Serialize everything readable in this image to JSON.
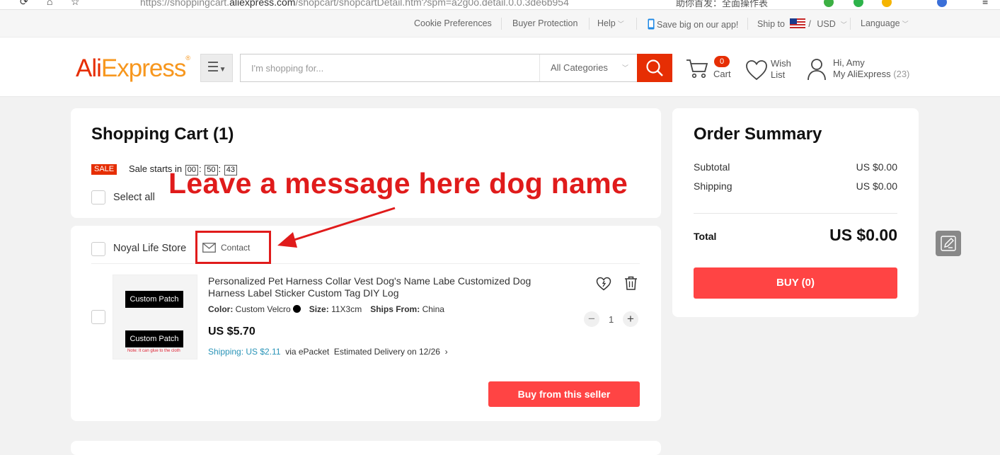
{
  "browser": {
    "url_prefix": "https://shoppingcart.",
    "url_domain": "aliexpress.com",
    "url_path": "/shopcart/shopcartDetail.htm?spm=a2g0o.detail.0.0.3de6b954",
    "cn_text": "助你首发：全面操作表"
  },
  "topnav": {
    "cookie": "Cookie Preferences",
    "buyer_protection": "Buyer Protection",
    "help": "Help",
    "app": "Save big on our app!",
    "ship_to": "Ship to",
    "currency_sep": "/",
    "currency": "USD",
    "language": "Language"
  },
  "header": {
    "logo_part1": "Ali",
    "logo_part2": "Express",
    "logo_tm": "®",
    "search_placeholder": "I'm shopping for...",
    "category": "All Categories",
    "cart_count": "0",
    "cart_label": "Cart",
    "wish_line1": "Wish",
    "wish_line2": "List",
    "greeting": "Hi, Amy",
    "account": "My AliExpress",
    "account_count": "(23)"
  },
  "cart": {
    "title": "Shopping Cart (1)",
    "sale_badge": "SALE",
    "sale_text": "Sale starts in",
    "timer_h": "00",
    "timer_m": "50",
    "timer_s": "43",
    "timer_sep": ":",
    "select_all": "Select all"
  },
  "annotation": {
    "text": "Leave a message here dog name"
  },
  "store": {
    "name": "Noyal Life Store",
    "contact": "Contact"
  },
  "product": {
    "image_text_1": "Custom Patch",
    "image_text_2": "Custom Patch",
    "image_note": "Note: It can glue to the cloth",
    "name": "Personalized Pet Harness Collar Vest Dog's Name Labe Customized Dog Harness Label Sticker Custom Tag DIY Log",
    "color_label": "Color:",
    "color_value": "Custom Velcro",
    "size_label": "Size:",
    "size_value": "11X3cm",
    "ships_label": "Ships From:",
    "ships_value": "China",
    "price": "US $5.70",
    "shipping_label": "Shipping: US $2.11",
    "shipping_via": "via ePacket",
    "delivery": "Estimated Delivery on 12/26",
    "quantity": "1",
    "buy_seller": "Buy from this seller"
  },
  "summary": {
    "title": "Order Summary",
    "subtotal_label": "Subtotal",
    "subtotal_value": "US $0.00",
    "shipping_label": "Shipping",
    "shipping_value": "US $0.00",
    "total_label": "Total",
    "total_value": "US $0.00",
    "buy_button": "BUY (0)"
  },
  "colors": {
    "brand_red": "#e62e04",
    "button_red": "#ff4444",
    "annotation_red": "#e01b1b",
    "shipping_teal": "#2a94b8"
  }
}
